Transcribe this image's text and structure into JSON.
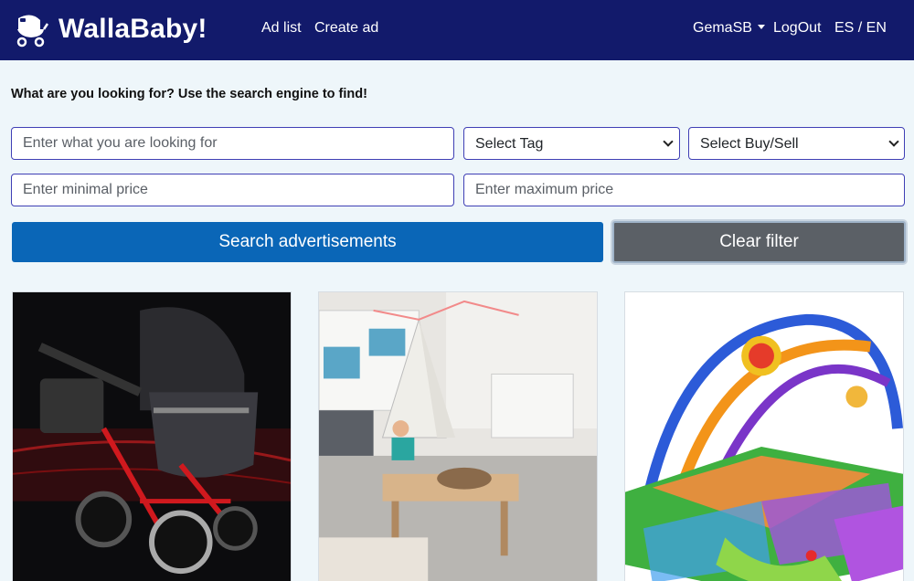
{
  "navbar": {
    "brand": "WallaBaby!",
    "links": {
      "ad_list": "Ad list",
      "create_ad": "Create ad"
    },
    "user": "GemaSB",
    "logout": "LogOut",
    "language": "ES / EN",
    "background": "#121a6b"
  },
  "search": {
    "heading": "What are you looking for? Use the search engine to find!",
    "query_placeholder": "Enter what you are looking for",
    "tag_selected": "Select Tag",
    "buysell_selected": "Select Buy/Sell",
    "min_price_placeholder": "Enter minimal price",
    "max_price_placeholder": "Enter maximum price",
    "search_button": "Search advertisements",
    "clear_button": "Clear filter"
  },
  "colors": {
    "accent": "#0a66b7",
    "secondary": "#5b6066",
    "page_bg": "#eef6fa"
  },
  "ads": [
    {
      "image": "stroller-photo"
    },
    {
      "image": "playroom-teepee-photo"
    },
    {
      "image": "baby-play-gym-photo"
    }
  ]
}
